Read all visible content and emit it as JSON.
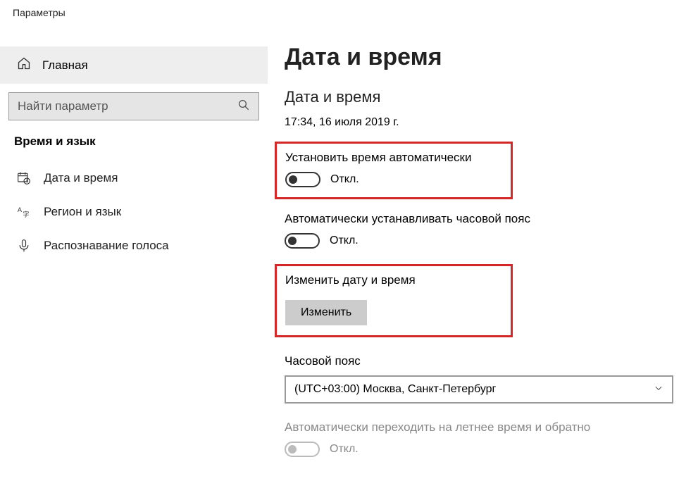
{
  "window": {
    "title": "Параметры"
  },
  "sidebar": {
    "home": "Главная",
    "search_placeholder": "Найти параметр",
    "category": "Время и язык",
    "items": [
      {
        "label": "Дата и время"
      },
      {
        "label": "Регион и язык"
      },
      {
        "label": "Распознавание голоса"
      }
    ]
  },
  "main": {
    "title": "Дата и время",
    "section": "Дата и время",
    "now": "17:34, 16 июля 2019 г.",
    "auto_time": {
      "label": "Установить время автоматически",
      "state": "Откл."
    },
    "auto_tz": {
      "label": "Автоматически устанавливать часовой пояс",
      "state": "Откл."
    },
    "change": {
      "label": "Изменить дату и время",
      "button": "Изменить"
    },
    "tz": {
      "label": "Часовой пояс",
      "value": "(UTC+03:00) Москва, Санкт-Петербург"
    },
    "dst": {
      "label": "Автоматически переходить на летнее время и обратно",
      "state": "Откл."
    }
  }
}
